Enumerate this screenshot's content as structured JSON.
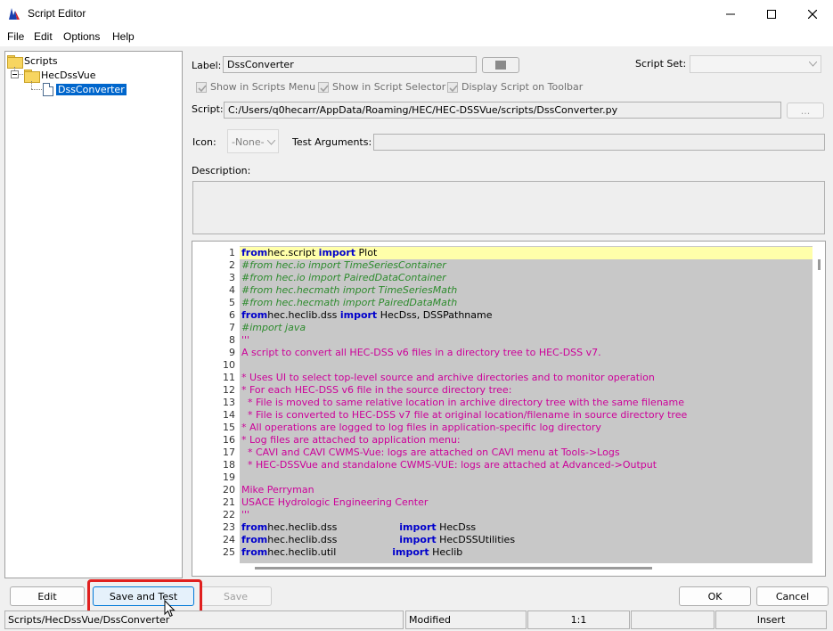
{
  "window": {
    "title": "Script Editor",
    "icon": "hec-dssvue-app-icon"
  },
  "menu": [
    "File",
    "Edit",
    "Options",
    "Help"
  ],
  "tree": {
    "root": "Scripts",
    "folder": "HecDssVue",
    "selected_item": "DssConverter"
  },
  "form": {
    "label_caption": "Label:",
    "label_value": "DssConverter",
    "script_set_caption": "Script Set:",
    "script_set_value": "",
    "show_in_scripts_menu": "Show in Scripts Menu",
    "show_in_script_selector": "Show in Script Selector",
    "display_on_toolbar": "Display Script on Toolbar",
    "script_caption": "Script:",
    "script_path": "C:/Users/q0hecarr/AppData/Roaming/HEC/HEC-DSSVue/scripts/DssConverter.py",
    "browse_label": "...",
    "icon_caption": "Icon:",
    "icon_value": "-None-",
    "test_args_caption": "Test Arguments:",
    "test_args_value": "",
    "description_caption": "Description:",
    "description_value": ""
  },
  "code_lines": [
    {
      "n": "1",
      "parts": [
        [
          "kw",
          "from"
        ],
        [
          "",
          "hec.script "
        ],
        [
          "kw",
          "import"
        ],
        [
          "",
          " Plot"
        ]
      ]
    },
    {
      "n": "2",
      "parts": [
        [
          "cm",
          "#from hec.io import TimeSeriesContainer"
        ]
      ]
    },
    {
      "n": "3",
      "parts": [
        [
          "cm",
          "#from hec.io import PairedDataContainer"
        ]
      ]
    },
    {
      "n": "4",
      "parts": [
        [
          "cm",
          "#from hec.hecmath import TimeSeriesMath"
        ]
      ]
    },
    {
      "n": "5",
      "parts": [
        [
          "cm",
          "#from hec.hecmath import PairedDataMath"
        ]
      ]
    },
    {
      "n": "6",
      "parts": [
        [
          "kw",
          "from"
        ],
        [
          "",
          "hec.heclib.dss "
        ],
        [
          "kw",
          "import"
        ],
        [
          "",
          " HecDss, DSSPathname"
        ]
      ]
    },
    {
      "n": "7",
      "parts": [
        [
          "cm",
          "#import java"
        ]
      ]
    },
    {
      "n": "8",
      "parts": [
        [
          "st",
          "'''"
        ]
      ]
    },
    {
      "n": "9",
      "parts": [
        [
          "st",
          "A script to convert all HEC-DSS v6 files in a directory tree to HEC-DSS v7."
        ]
      ]
    },
    {
      "n": "10",
      "parts": [
        [
          "",
          ""
        ]
      ]
    },
    {
      "n": "11",
      "parts": [
        [
          "st",
          "* Uses UI to select top-level source and archive directories and to monitor operation"
        ]
      ]
    },
    {
      "n": "12",
      "parts": [
        [
          "st",
          "* For each HEC-DSS v6 file in the source directory tree:"
        ]
      ]
    },
    {
      "n": "13",
      "parts": [
        [
          "st",
          "  * File is moved to same relative location in archive directory tree with the same filename"
        ]
      ]
    },
    {
      "n": "14",
      "parts": [
        [
          "st",
          "  * File is converted to HEC-DSS v7 file at original location/filename in source directory tree"
        ]
      ]
    },
    {
      "n": "15",
      "parts": [
        [
          "st",
          "* All operations are logged to log files in application-specific log directory"
        ]
      ]
    },
    {
      "n": "16",
      "parts": [
        [
          "st",
          "* Log files are attached to application menu:"
        ]
      ]
    },
    {
      "n": "17",
      "parts": [
        [
          "st",
          "  * CAVI and CAVI CWMS-Vue: logs are attached on CAVI menu at Tools->Logs"
        ]
      ]
    },
    {
      "n": "18",
      "parts": [
        [
          "st",
          "  * HEC-DSSVue and standalone CWMS-VUE: logs are attached at Advanced->Output"
        ]
      ]
    },
    {
      "n": "19",
      "parts": [
        [
          "",
          ""
        ]
      ]
    },
    {
      "n": "20",
      "parts": [
        [
          "st",
          "Mike Perryman"
        ]
      ]
    },
    {
      "n": "21",
      "parts": [
        [
          "st",
          "USACE Hydrologic Engineering Center"
        ]
      ]
    },
    {
      "n": "22",
      "parts": [
        [
          "st",
          "'''"
        ]
      ]
    },
    {
      "n": "23",
      "parts": [
        [
          "kw",
          "from"
        ],
        [
          "",
          "hec.heclib.dss                    "
        ],
        [
          "kw",
          "import"
        ],
        [
          "",
          " HecDss"
        ]
      ]
    },
    {
      "n": "24",
      "parts": [
        [
          "kw",
          "from"
        ],
        [
          "",
          "hec.heclib.dss                    "
        ],
        [
          "kw",
          "import"
        ],
        [
          "",
          " HecDSSUtilities"
        ]
      ]
    },
    {
      "n": "25",
      "parts": [
        [
          "kw",
          "from"
        ],
        [
          "",
          "hec.heclib.util                  "
        ],
        [
          "kw",
          "import"
        ],
        [
          "",
          " Heclib"
        ]
      ]
    }
  ],
  "buttons": {
    "edit": "Edit",
    "save_and_test": "Save and Test",
    "save": "Save",
    "ok": "OK",
    "cancel": "Cancel"
  },
  "status": {
    "path": "Scripts/HecDssVue/DssConverter",
    "state": "Modified",
    "position": "1:1",
    "extra": "",
    "mode": "Insert"
  },
  "colors": {
    "keyword": "#0000cc",
    "comment": "#2e8b2e",
    "string": "#cc0099",
    "selection": "#0066cc",
    "highlight_box": "#e0201f"
  }
}
